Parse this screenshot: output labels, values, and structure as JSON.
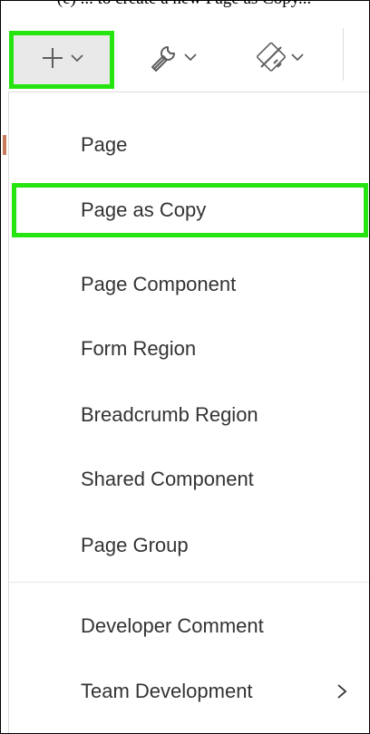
{
  "caption": "(e) ... to create a new Page as Copy...",
  "toolbar": {
    "create_icon": "plus-icon",
    "utilities_icon": "wrench-icon",
    "shared_icon": "shared-components-icon"
  },
  "menu": {
    "items": [
      {
        "label": "Page"
      },
      {
        "label": "Page as Copy"
      },
      {
        "label": "Page Component"
      },
      {
        "label": "Form Region"
      },
      {
        "label": "Breadcrumb Region"
      },
      {
        "label": "Shared Component"
      },
      {
        "label": "Page Group"
      },
      {
        "label": "Developer Comment"
      },
      {
        "label": "Team Development"
      }
    ]
  },
  "colors": {
    "highlight": "#25e40f",
    "text": "#333333",
    "icon": "#5e5e5e"
  }
}
